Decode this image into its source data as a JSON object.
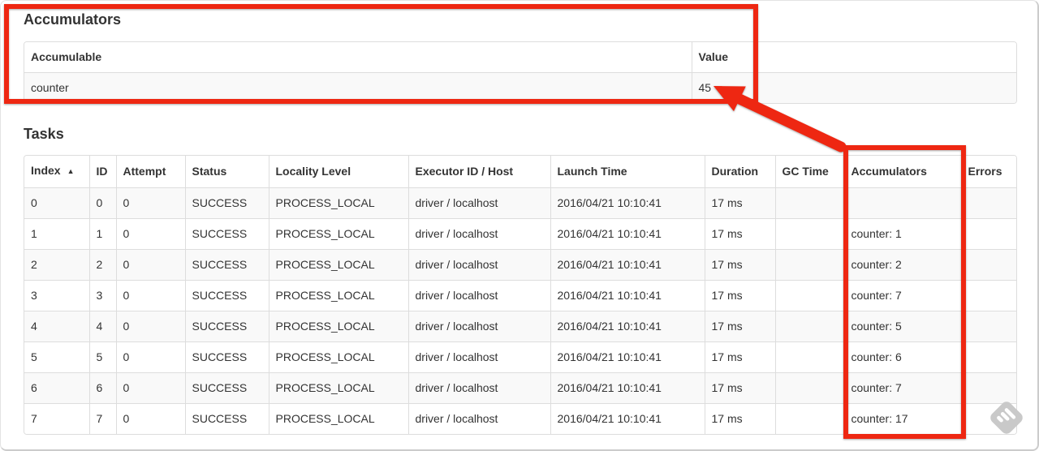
{
  "accumulators_section": {
    "title": "Accumulators",
    "table": {
      "headers": [
        "Accumulable",
        "Value"
      ],
      "rows": [
        {
          "accumulable": "counter",
          "value": "45"
        }
      ]
    }
  },
  "tasks_section": {
    "title": "Tasks",
    "table": {
      "headers": [
        "Index",
        "ID",
        "Attempt",
        "Status",
        "Locality Level",
        "Executor ID / Host",
        "Launch Time",
        "Duration",
        "GC Time",
        "Accumulators",
        "Errors"
      ],
      "sort_column": "Index",
      "sort_indicator": "▲",
      "rows": [
        {
          "index": "0",
          "id": "0",
          "attempt": "0",
          "status": "SUCCESS",
          "locality_level": "PROCESS_LOCAL",
          "executor_id_host": "driver / localhost",
          "launch_time": "2016/04/21 10:10:41",
          "duration": "17 ms",
          "gc_time": "",
          "accumulators": "",
          "errors": ""
        },
        {
          "index": "1",
          "id": "1",
          "attempt": "0",
          "status": "SUCCESS",
          "locality_level": "PROCESS_LOCAL",
          "executor_id_host": "driver / localhost",
          "launch_time": "2016/04/21 10:10:41",
          "duration": "17 ms",
          "gc_time": "",
          "accumulators": "counter: 1",
          "errors": ""
        },
        {
          "index": "2",
          "id": "2",
          "attempt": "0",
          "status": "SUCCESS",
          "locality_level": "PROCESS_LOCAL",
          "executor_id_host": "driver / localhost",
          "launch_time": "2016/04/21 10:10:41",
          "duration": "17 ms",
          "gc_time": "",
          "accumulators": "counter: 2",
          "errors": ""
        },
        {
          "index": "3",
          "id": "3",
          "attempt": "0",
          "status": "SUCCESS",
          "locality_level": "PROCESS_LOCAL",
          "executor_id_host": "driver / localhost",
          "launch_time": "2016/04/21 10:10:41",
          "duration": "17 ms",
          "gc_time": "",
          "accumulators": "counter: 7",
          "errors": ""
        },
        {
          "index": "4",
          "id": "4",
          "attempt": "0",
          "status": "SUCCESS",
          "locality_level": "PROCESS_LOCAL",
          "executor_id_host": "driver / localhost",
          "launch_time": "2016/04/21 10:10:41",
          "duration": "17 ms",
          "gc_time": "",
          "accumulators": "counter: 5",
          "errors": ""
        },
        {
          "index": "5",
          "id": "5",
          "attempt": "0",
          "status": "SUCCESS",
          "locality_level": "PROCESS_LOCAL",
          "executor_id_host": "driver / localhost",
          "launch_time": "2016/04/21 10:10:41",
          "duration": "17 ms",
          "gc_time": "",
          "accumulators": "counter: 6",
          "errors": ""
        },
        {
          "index": "6",
          "id": "6",
          "attempt": "0",
          "status": "SUCCESS",
          "locality_level": "PROCESS_LOCAL",
          "executor_id_host": "driver / localhost",
          "launch_time": "2016/04/21 10:10:41",
          "duration": "17 ms",
          "gc_time": "",
          "accumulators": "counter: 7",
          "errors": ""
        },
        {
          "index": "7",
          "id": "7",
          "attempt": "0",
          "status": "SUCCESS",
          "locality_level": "PROCESS_LOCAL",
          "executor_id_host": "driver / localhost",
          "launch_time": "2016/04/21 10:10:41",
          "duration": "17 ms",
          "gc_time": "",
          "accumulators": "counter: 17",
          "errors": ""
        }
      ]
    }
  },
  "annotations": {
    "color": "#ee2712",
    "shapes": [
      "box-around-accumulators-section",
      "box-around-accumulators-column",
      "arrow-pointing-at-value-45"
    ]
  },
  "watermark": {
    "icon": "skitch-diamond-icon",
    "color": "#c9c9c9"
  }
}
